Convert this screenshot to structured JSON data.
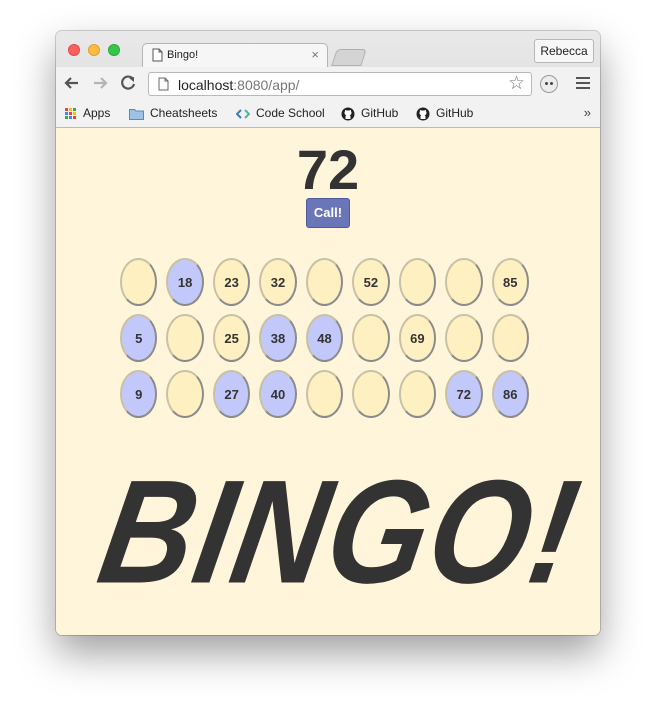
{
  "browser": {
    "tab_title": "Bingo!",
    "tab_close": "×",
    "profile_name": "Rebecca",
    "url_host": "localhost",
    "url_rest": ":8080/app/",
    "bookmarks": [
      "Apps",
      "Cheatsheets",
      "Code School",
      "GitHub",
      "GitHub"
    ],
    "bookmarks_more": "»"
  },
  "game": {
    "current_number": "72",
    "call_label": "Call!",
    "banner": "BINGO!",
    "board": [
      [
        {
          "n": "",
          "m": false
        },
        {
          "n": "18",
          "m": true
        },
        {
          "n": "23",
          "m": false
        },
        {
          "n": "32",
          "m": false
        },
        {
          "n": "",
          "m": false
        },
        {
          "n": "52",
          "m": false
        },
        {
          "n": "",
          "m": false
        },
        {
          "n": "",
          "m": false
        },
        {
          "n": "85",
          "m": false
        }
      ],
      [
        {
          "n": "5",
          "m": true
        },
        {
          "n": "",
          "m": false
        },
        {
          "n": "25",
          "m": false
        },
        {
          "n": "38",
          "m": true
        },
        {
          "n": "48",
          "m": true
        },
        {
          "n": "",
          "m": false
        },
        {
          "n": "69",
          "m": false
        },
        {
          "n": "",
          "m": false
        },
        {
          "n": "",
          "m": false
        }
      ],
      [
        {
          "n": "9",
          "m": true
        },
        {
          "n": "",
          "m": false
        },
        {
          "n": "27",
          "m": true
        },
        {
          "n": "40",
          "m": true
        },
        {
          "n": "",
          "m": false
        },
        {
          "n": "",
          "m": false
        },
        {
          "n": "",
          "m": false
        },
        {
          "n": "72",
          "m": true
        },
        {
          "n": "86",
          "m": true
        }
      ]
    ]
  },
  "colors": {
    "page_background": "#fff5da",
    "cell_unmarked": "#fff0c2",
    "cell_marked": "#c3c8fb",
    "call_button": "#6a76b8"
  }
}
